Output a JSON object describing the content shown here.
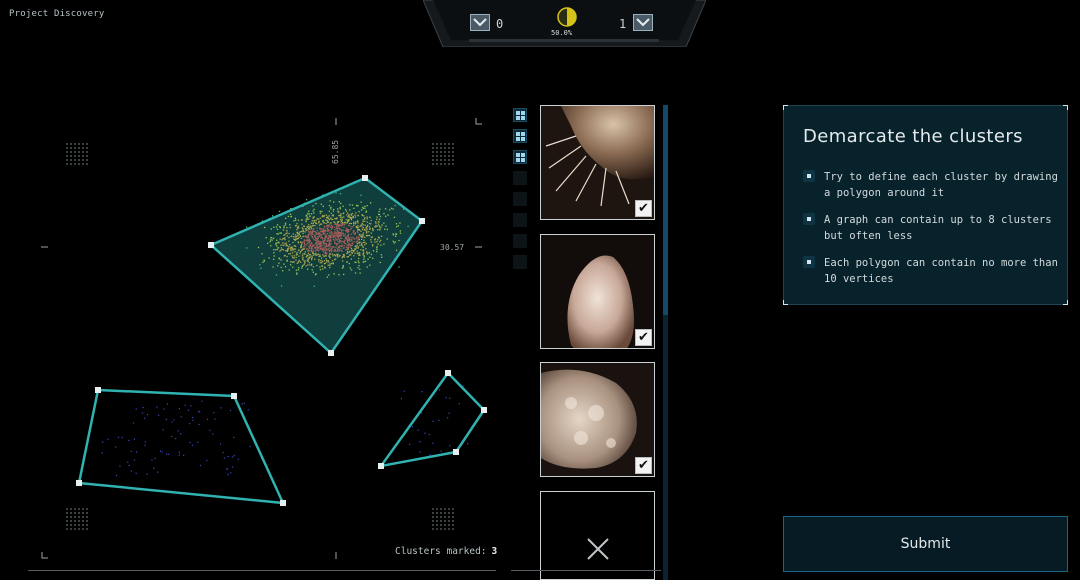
{
  "app": {
    "title": "Project Discovery"
  },
  "hud": {
    "left_score": "0",
    "right_score": "1",
    "progress_label": "50.0%",
    "progress_fraction": 0.5,
    "accent_color": "#d6c21a"
  },
  "plot": {
    "y_tick_label": "65.85",
    "x_tick_label": "30.57",
    "clusters_marked_label": "Clusters marked:",
    "clusters_marked_value": "3",
    "polygon_color": "#2fb2b0"
  },
  "thumbnails": {
    "view_buttons": [
      "grid-1",
      "grid-2",
      "grid-3",
      "empty",
      "empty",
      "empty",
      "empty",
      "empty"
    ],
    "items": [
      {
        "state": "checked",
        "check_glyph": "✔"
      },
      {
        "state": "checked",
        "check_glyph": "✔"
      },
      {
        "state": "checked",
        "check_glyph": "✔"
      },
      {
        "state": "empty"
      }
    ]
  },
  "instructions": {
    "title": "Demarcate the clusters",
    "items": [
      "Try to define each cluster by drawing a polygon around it",
      "A graph can contain up to 8 clusters but often less",
      "Each polygon can contain no more than 10 vertices"
    ]
  },
  "submit": {
    "label": "Submit"
  }
}
